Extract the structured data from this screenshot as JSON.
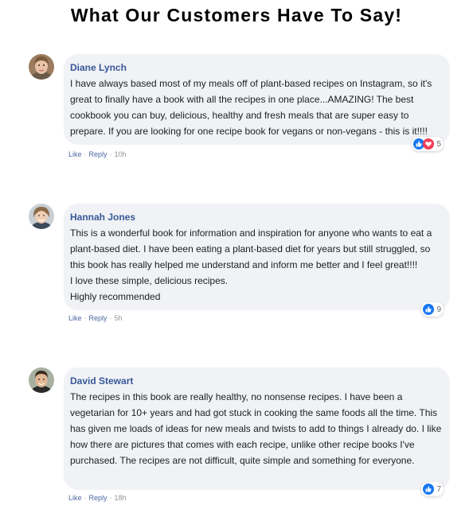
{
  "page": {
    "title": "What Our Customers Have To Say!"
  },
  "actions": {
    "like": "Like",
    "reply": "Reply",
    "separator": "·"
  },
  "colors": {
    "author": "#385898",
    "bubble": "#f0f2f5",
    "like": "#1877f2",
    "love": "#f33e58"
  },
  "comments": [
    {
      "author": "Diane Lynch",
      "text": "I have always based most of my meals off of plant-based recipes on Instagram, so it's great to finally have a book with all the recipes in one place...AMAZING! The best cookbook you can buy, delicious, healthy and fresh meals that are super easy to prepare. If you are looking for one recipe book for vegans or non-vegans - this is it!!!!",
      "reactions": [
        "like-icon",
        "love-icon"
      ],
      "reaction_count": "5",
      "time": "10h"
    },
    {
      "author": "Hannah Jones",
      "text": "This is a wonderful book for information and inspiration for anyone who wants to eat a plant-based diet. I have been eating a plant-based diet for years but still struggled, so this book has really helped me understand and inform me better and I feel great!!!!\nI love these simple, delicious recipes.\nHighly recommended",
      "reactions": [
        "like-icon"
      ],
      "reaction_count": "9",
      "time": "5h"
    },
    {
      "author": "David Stewart",
      "text": "The recipes in this book are really healthy, no nonsense recipes. I have been a vegetarian for 10+ years and had got stuck in cooking the same foods all the time. This has given me loads of ideas for new meals and twists to add to things I already do. I like how there are pictures that comes with each recipe, unlike other recipe books I've purchased. The recipes are not difficult, quite simple and something for everyone.",
      "reactions": [
        "like-icon"
      ],
      "reaction_count": "7",
      "time": "18h"
    }
  ]
}
